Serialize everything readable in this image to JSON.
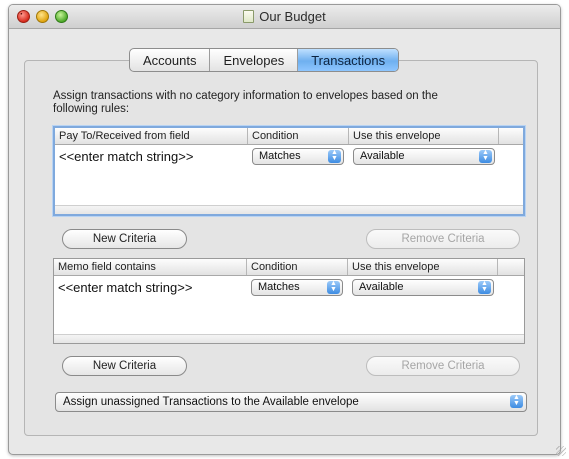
{
  "window": {
    "title": "Our Budget",
    "accent_color": "#6fb0ef"
  },
  "tabs": [
    {
      "label": "Accounts",
      "active": false
    },
    {
      "label": "Envelopes",
      "active": false
    },
    {
      "label": "Transactions",
      "active": true
    }
  ],
  "description": "Assign transactions with no category information to envelopes based on the following rules:",
  "payee_table": {
    "headers": [
      "Pay To/Received from field",
      "Condition",
      "Use this envelope"
    ],
    "rows": [
      {
        "match": "<<enter match string>>",
        "condition": "Matches",
        "envelope": "Available"
      }
    ],
    "new_label": "New Criteria",
    "remove_label": "Remove Criteria"
  },
  "memo_table": {
    "headers": [
      "Memo field contains",
      "Condition",
      "Use this envelope"
    ],
    "rows": [
      {
        "match": "<<enter match string>>",
        "condition": "Matches",
        "envelope": "Available"
      }
    ],
    "new_label": "New Criteria",
    "remove_label": "Remove Criteria"
  },
  "unassigned_option": "Assign unassigned Transactions to the Available envelope",
  "icons": {
    "close": "close-icon",
    "minimize": "minimize-icon",
    "zoom": "zoom-icon",
    "stepper": "popup-stepper-icon"
  }
}
